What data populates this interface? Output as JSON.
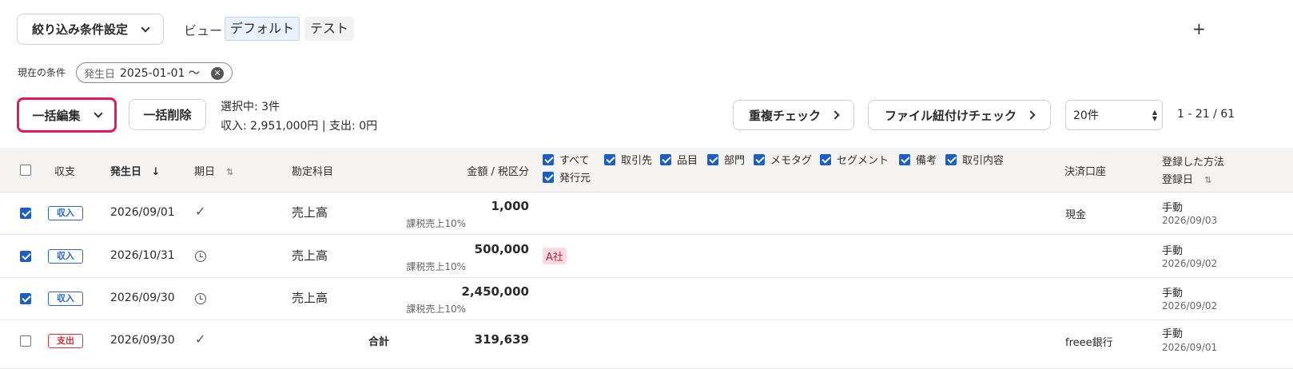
{
  "filter": {
    "button_label": "絞り込み条件設定"
  },
  "views": {
    "label": "ビュー",
    "items": [
      "デフォルト",
      "テスト"
    ],
    "add_label": "+"
  },
  "conditions": {
    "label": "現在の条件",
    "chip_field": "発生日",
    "chip_value": "2025-01-01 〜"
  },
  "actions": {
    "bulk_edit": "一括編集",
    "bulk_delete": "一括削除",
    "selection_count": "選択中: 3件",
    "selection_totals": "収入: 2,951,000円 | 支出: 0円",
    "duplicate_check": "重複チェック",
    "file_link_check": "ファイル紐付けチェック",
    "per_page": "20件",
    "range": "1 - 21 / 61"
  },
  "table": {
    "headers": {
      "type": "収支",
      "date": "発生日",
      "due": "期日",
      "account": "勘定科目",
      "amount": "金額 / 税区分",
      "account_wallet": "決済口座",
      "method_line1": "登録した方法",
      "method_line2": "登録日"
    },
    "column_toggles": [
      {
        "label": "すべて",
        "checked": true
      },
      {
        "label": "取引先",
        "checked": true
      },
      {
        "label": "品目",
        "checked": true
      },
      {
        "label": "部門",
        "checked": true
      },
      {
        "label": "メモタグ",
        "checked": true
      },
      {
        "label": "セグメント",
        "checked": true
      },
      {
        "label": "備考",
        "checked": true
      },
      {
        "label": "取引内容",
        "checked": true
      },
      {
        "label": "発行元",
        "checked": true
      }
    ],
    "rows": [
      {
        "checked": true,
        "type": "収入",
        "date": "2026/09/01",
        "status": "check",
        "account": "売上高",
        "amount": "1,000",
        "tax": "課税売上10%",
        "tag": "",
        "wallet": "現金",
        "method": "手動",
        "registered": "2026/09/03"
      },
      {
        "checked": true,
        "type": "収入",
        "date": "2026/10/31",
        "status": "clock",
        "account": "売上高",
        "amount": "500,000",
        "tax": "課税売上10%",
        "tag": "A社",
        "wallet": "",
        "method": "手動",
        "registered": "2026/09/02"
      },
      {
        "checked": true,
        "type": "収入",
        "date": "2026/09/30",
        "status": "clock",
        "account": "売上高",
        "amount": "2,450,000",
        "tax": "課税売上10%",
        "tag": "",
        "wallet": "",
        "method": "手動",
        "registered": "2026/09/02"
      },
      {
        "checked": false,
        "type": "支出",
        "date": "2026/09/30",
        "status": "check",
        "account": "合計",
        "amount": "319,639",
        "tax": "",
        "tag": "",
        "wallet": "freee銀行",
        "method": "手動",
        "registered": "2026/09/01"
      }
    ]
  },
  "colors": {
    "highlight": "#e8175d",
    "income": "#2e64c4",
    "expense": "#d6303b",
    "check": "#1a5fc8",
    "header_bg": "#f5f3f2",
    "tag_bg": "#fbdbe0"
  }
}
